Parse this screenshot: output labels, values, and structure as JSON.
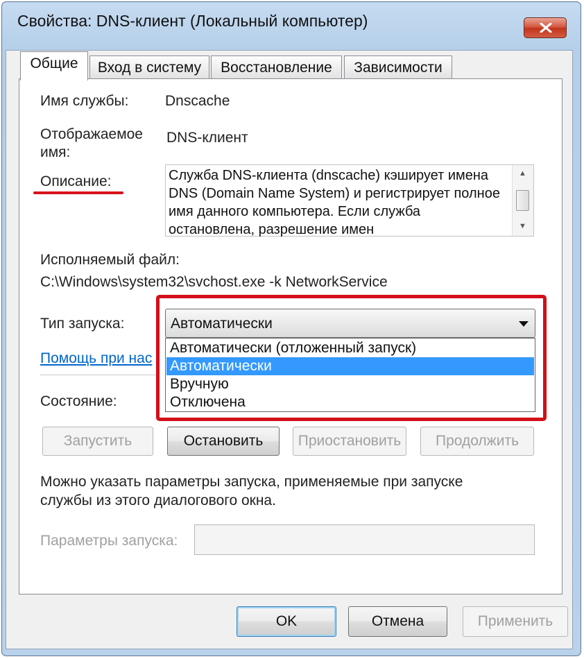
{
  "window": {
    "title": "Свойства: DNS-клиент (Локальный компьютер)"
  },
  "tabs": [
    {
      "label": "Общие",
      "active": true
    },
    {
      "label": "Вход в систему",
      "active": false
    },
    {
      "label": "Восстановление",
      "active": false
    },
    {
      "label": "Зависимости",
      "active": false
    }
  ],
  "general": {
    "service_name_label": "Имя службы:",
    "service_name_value": "Dnscache",
    "display_name_label_line1": "Отображаемое",
    "display_name_label_line2": "имя:",
    "display_name_value": "DNS-клиент",
    "description_label": "Описание:",
    "description_text": "Служба DNS-клиента (dnscache) кэширует имена DNS (Domain Name System) и регистрирует полное имя данного компьютера. Если служба остановлена, разрешение имен",
    "exe_label": "Исполняемый файл:",
    "exe_path": "C:\\Windows\\system32\\svchost.exe -k NetworkService",
    "startup_type_label": "Тип запуска:",
    "startup_type_value": "Автоматически",
    "startup_options": [
      {
        "label": "Автоматически (отложенный запуск)",
        "selected": false
      },
      {
        "label": "Автоматически",
        "selected": true
      },
      {
        "label": "Вручную",
        "selected": false
      },
      {
        "label": "Отключена",
        "selected": false
      }
    ],
    "help_link": "Помощь при нас",
    "status_label": "Состояние:",
    "buttons": {
      "start": "Запустить",
      "stop": "Остановить",
      "pause": "Приостановить",
      "resume": "Продолжить"
    },
    "start_params_note_line1": "Можно указать параметры запуска, применяемые при запуске",
    "start_params_note_line2": "службы из этого диалогового окна.",
    "start_params_label": "Параметры запуска:",
    "start_params_value": ""
  },
  "footer": {
    "ok": "OK",
    "cancel": "Отмена",
    "apply": "Применить"
  },
  "colors": {
    "highlight": "#3399ff",
    "annotation_red": "#d20f1a",
    "link": "#0066cc"
  }
}
